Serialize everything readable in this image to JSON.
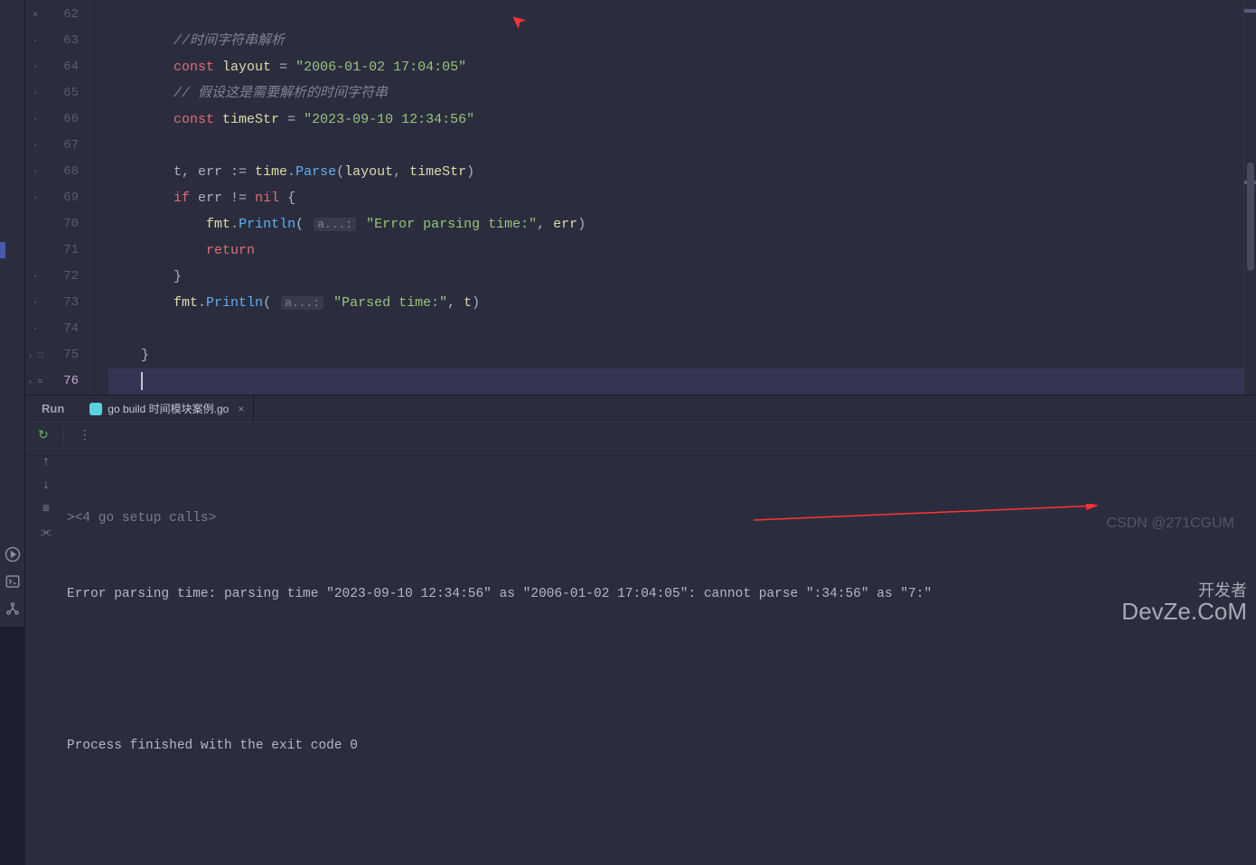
{
  "editor": {
    "lines": [
      {
        "num": "62",
        "fold": "x"
      },
      {
        "num": "63"
      },
      {
        "num": "64"
      },
      {
        "num": "65"
      },
      {
        "num": "66"
      },
      {
        "num": "67"
      },
      {
        "num": "68"
      },
      {
        "num": "69"
      },
      {
        "num": "70"
      },
      {
        "num": "71"
      },
      {
        "num": "72"
      },
      {
        "num": "73"
      },
      {
        "num": "74"
      },
      {
        "num": "75",
        "fold": "> D"
      },
      {
        "num": "76",
        "fold": "> E",
        "cursor": true
      }
    ],
    "code": {
      "comment_parse": "//时间字符串解析",
      "const1": "const",
      "layout_var": "layout",
      "eq": " = ",
      "layout_str": "\"2006-01-02 17:04:05\"",
      "comment_assume": "// 假设这是需要解析的时间字符串",
      "timestr_var": "timeStr",
      "timestr_str": "\"2023-09-10 12:34:56\"",
      "t_err": "t, err := ",
      "time_pkg": "time",
      "parse_fn": "Parse",
      "parse_args_layout": "layout",
      "parse_args_timestr": "timeStr",
      "if_kw": "if",
      "if_cond": " err != ",
      "nil_kw": "nil",
      "brace_open": " {",
      "fmt_pkg": "fmt",
      "println_fn": "Println",
      "hint_a": "a...:",
      "err_str": "\"Error parsing time:\"",
      "err_arg": "err",
      "return_kw": "return",
      "brace_close": "}",
      "parsed_str": "\"Parsed time:\"",
      "t_arg": "t"
    }
  },
  "run_panel": {
    "tab_label": "Run",
    "tab_name": "go build 时间模块案例.go",
    "setup_line": "><4 go setup calls>",
    "error_line": "Error parsing time: parsing time \"2023-09-10 12:34:56\" as \"2006-01-02 17:04:05\": cannot parse \":34:56\" as \"7:\"",
    "blank_line": "",
    "exit_line": "Process finished with the exit code 0"
  },
  "watermarks": {
    "csdn": "CSDN @271CGUM",
    "devze": "开发者\nDevZe.CoM"
  }
}
